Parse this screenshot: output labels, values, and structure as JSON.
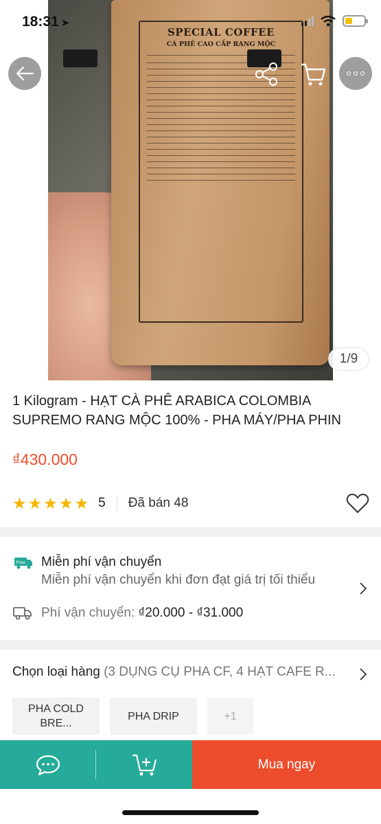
{
  "status": {
    "time": "18:31"
  },
  "gallery": {
    "counter": "1/9",
    "bag_label_title": "SPECIAL COFFEE",
    "bag_label_subtitle": "CÀ PHÊ CAO CẤP RANG MỘC"
  },
  "product": {
    "title": "1 Kilogram - HẠT CÀ PHÊ ARABICA COLOMBIA SUPREMO RANG MỘC 100% - PHA MÁY/PHA PHIN",
    "price": "₫430.000",
    "rating": "5",
    "rating_stars": 5,
    "sold": "Đã bán 48"
  },
  "shipping": {
    "badge": "Free",
    "title": "Miễn phí vận chuyển",
    "subtitle": "Miễn phí vận chuyển khi đơn đạt giá trị tối thiểu",
    "fee_label": "Phí vận chuyển:",
    "fee_value": "₫20.000 - ₫31.000"
  },
  "variations": {
    "label": "Chọn loại hàng",
    "summary": "(3 DỤNG CỤ PHA CF, 4 HẠT CAFE R...",
    "options": [
      "PHA COLD BRE...",
      "PHA DRIP",
      "+1"
    ]
  },
  "bottom_bar": {
    "buy_label": "Mua ngay"
  },
  "colors": {
    "accent": "#ee4d2d",
    "teal": "#26aa99",
    "star": "#f6b600"
  }
}
